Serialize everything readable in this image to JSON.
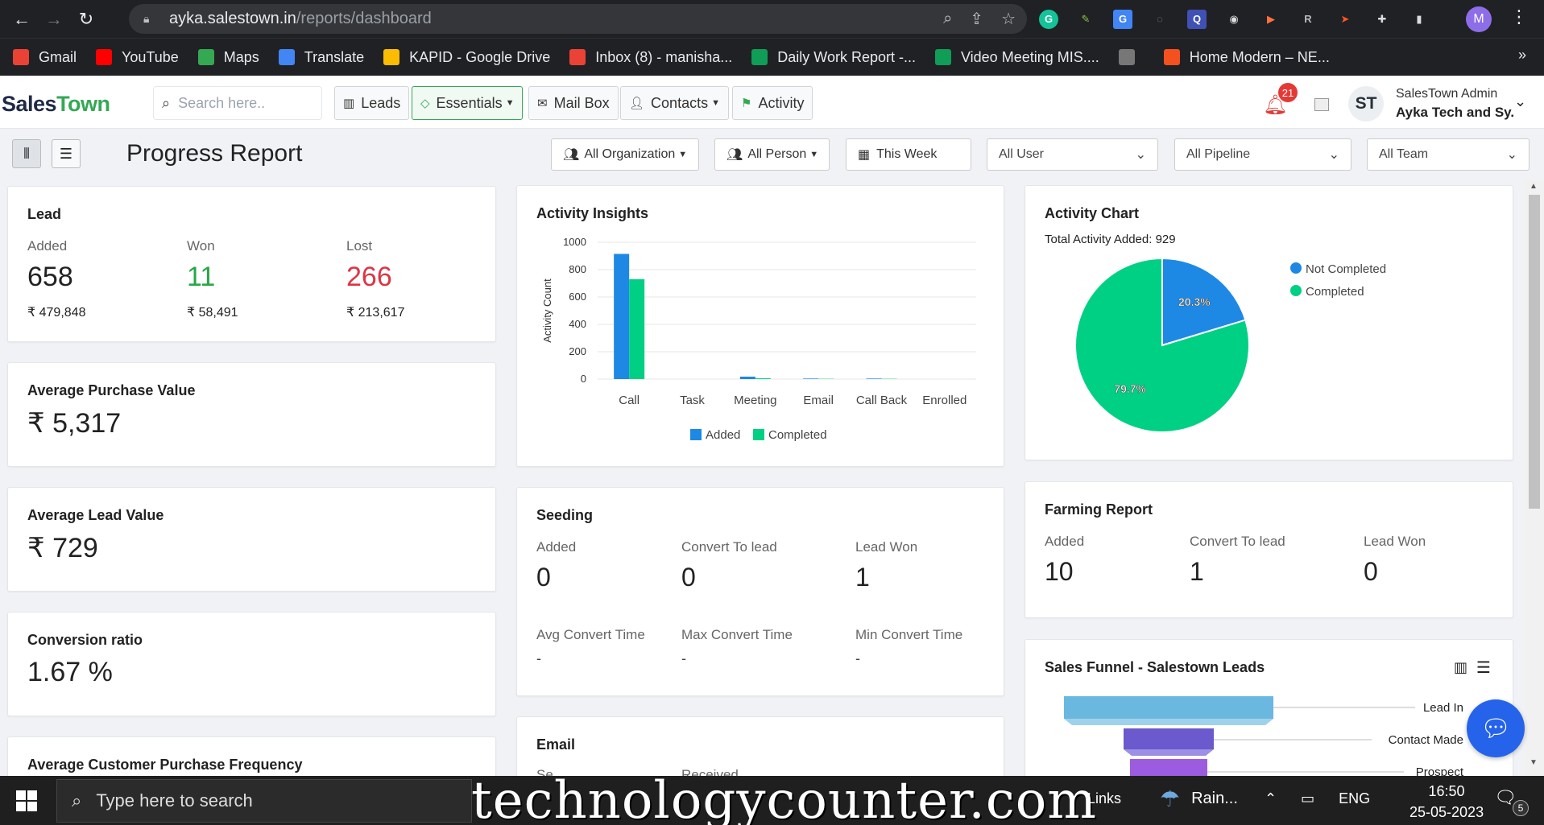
{
  "browser": {
    "url_host": "ayka.salestown.in",
    "url_path": "/reports/dashboard"
  },
  "bookmarks": [
    {
      "label": "Gmail",
      "icon": "gmail-icon",
      "color": "#ea4335"
    },
    {
      "label": "YouTube",
      "icon": "youtube-icon",
      "color": "#ff0000"
    },
    {
      "label": "Maps",
      "icon": "maps-icon",
      "color": "#34a853"
    },
    {
      "label": "Translate",
      "icon": "translate-icon",
      "color": "#4285f4"
    },
    {
      "label": "KAPID - Google Drive",
      "icon": "drive-icon",
      "color": "#fbbc04"
    },
    {
      "label": "Inbox (8) - manisha...",
      "icon": "gmail-icon",
      "color": "#ea4335"
    },
    {
      "label": "Daily Work Report -...",
      "icon": "sheets-icon",
      "color": "#0f9d58"
    },
    {
      "label": "Video Meeting MIS....",
      "icon": "sheets-icon",
      "color": "#0f9d58"
    },
    {
      "label": "",
      "icon": "globe-icon",
      "color": "#777777"
    },
    {
      "label": "Home Modern – NE...",
      "icon": "layers-icon",
      "color": "#f4511e"
    }
  ],
  "app": {
    "logo_main": "Sales",
    "logo_accent": "Town",
    "search_placeholder": "Search here..",
    "nav": {
      "leads": "Leads",
      "essentials": "Essentials",
      "mailbox": "Mail Box",
      "contacts": "Contacts",
      "activity": "Activity"
    },
    "notification_count": "21",
    "avatar_initials": "ST",
    "user_name": "SalesTown Admin",
    "user_company": "Ayka Tech and Sy."
  },
  "toolbar": {
    "page_title": "Progress Report",
    "org_filter": "All Organization",
    "person_filter": "All Person",
    "date_filter": "This Week",
    "user_select": "All User",
    "pipeline_select": "All Pipeline",
    "team_select": "All Team"
  },
  "lead": {
    "title": "Lead",
    "added_label": "Added",
    "added_value": "658",
    "added_amount": "₹ 479,848",
    "won_label": "Won",
    "won_value": "11",
    "won_amount": "₹ 58,491",
    "lost_label": "Lost",
    "lost_value": "266",
    "lost_amount": "₹ 213,617",
    "won_color": "#28a745",
    "lost_color": "#dc3545"
  },
  "avg_purchase": {
    "title": "Average Purchase Value",
    "value": "₹ 5,317"
  },
  "avg_lead": {
    "title": "Average Lead Value",
    "value": "₹ 729"
  },
  "conversion": {
    "title": "Conversion ratio",
    "value": "1.67 %"
  },
  "avg_frequency": {
    "title": "Average Customer Purchase Frequency"
  },
  "activity_insights": {
    "title": "Activity Insights"
  },
  "activity_chart": {
    "title": "Activity Chart",
    "total": "Total Activity Added: 929"
  },
  "seeding": {
    "title": "Seeding",
    "added_label": "Added",
    "added_value": "0",
    "convert_label": "Convert To lead",
    "convert_value": "0",
    "won_label": "Lead Won",
    "won_value": "1",
    "avg_label": "Avg Convert Time",
    "avg_value": "-",
    "max_label": "Max Convert Time",
    "max_value": "-",
    "min_label": "Min Convert Time",
    "min_value": "-"
  },
  "farming": {
    "title": "Farming Report",
    "added_label": "Added",
    "added_value": "10",
    "convert_label": "Convert To lead",
    "convert_value": "1",
    "won_label": "Lead Won",
    "won_value": "0"
  },
  "email": {
    "title": "Email",
    "sent_partial": "Se",
    "received_partial": "Received"
  },
  "funnel": {
    "title": "Sales Funnel - Salestown Leads",
    "stages": [
      "Lead In",
      "Contact Made",
      "Prospect"
    ]
  },
  "chart_data": [
    {
      "type": "bar",
      "title": "Activity Insights",
      "ylabel": "Activity Count",
      "xlabel": "",
      "categories": [
        "Call",
        "Task",
        "Meeting",
        "Email",
        "Call Back",
        "Enrolled"
      ],
      "series": [
        {
          "name": "Added",
          "values": [
            915,
            0,
            18,
            4,
            4,
            0
          ],
          "color": "#1e88e5"
        },
        {
          "name": "Completed",
          "values": [
            730,
            0,
            6,
            2,
            2,
            0
          ],
          "color": "#00d084"
        }
      ],
      "ylim": [
        0,
        1000
      ],
      "yticks": [
        0,
        200,
        400,
        600,
        800,
        1000
      ],
      "grid": true,
      "legend": "bottom"
    },
    {
      "type": "pie",
      "title": "Activity Chart",
      "slices": [
        {
          "label": "Not Completed",
          "value": 20.3,
          "text": "20.3%",
          "color": "#1e88e5"
        },
        {
          "label": "Completed",
          "value": 79.7,
          "text": "79.7%",
          "color": "#00d084"
        }
      ],
      "legend": "right"
    }
  ],
  "taskbar": {
    "search_placeholder": "Type here to search",
    "watermark": "technologycounter.com",
    "links": "Links",
    "weather": "Rain...",
    "lang": "ENG",
    "time": "16:50",
    "date": "25-05-2023",
    "notification_count": "5"
  }
}
